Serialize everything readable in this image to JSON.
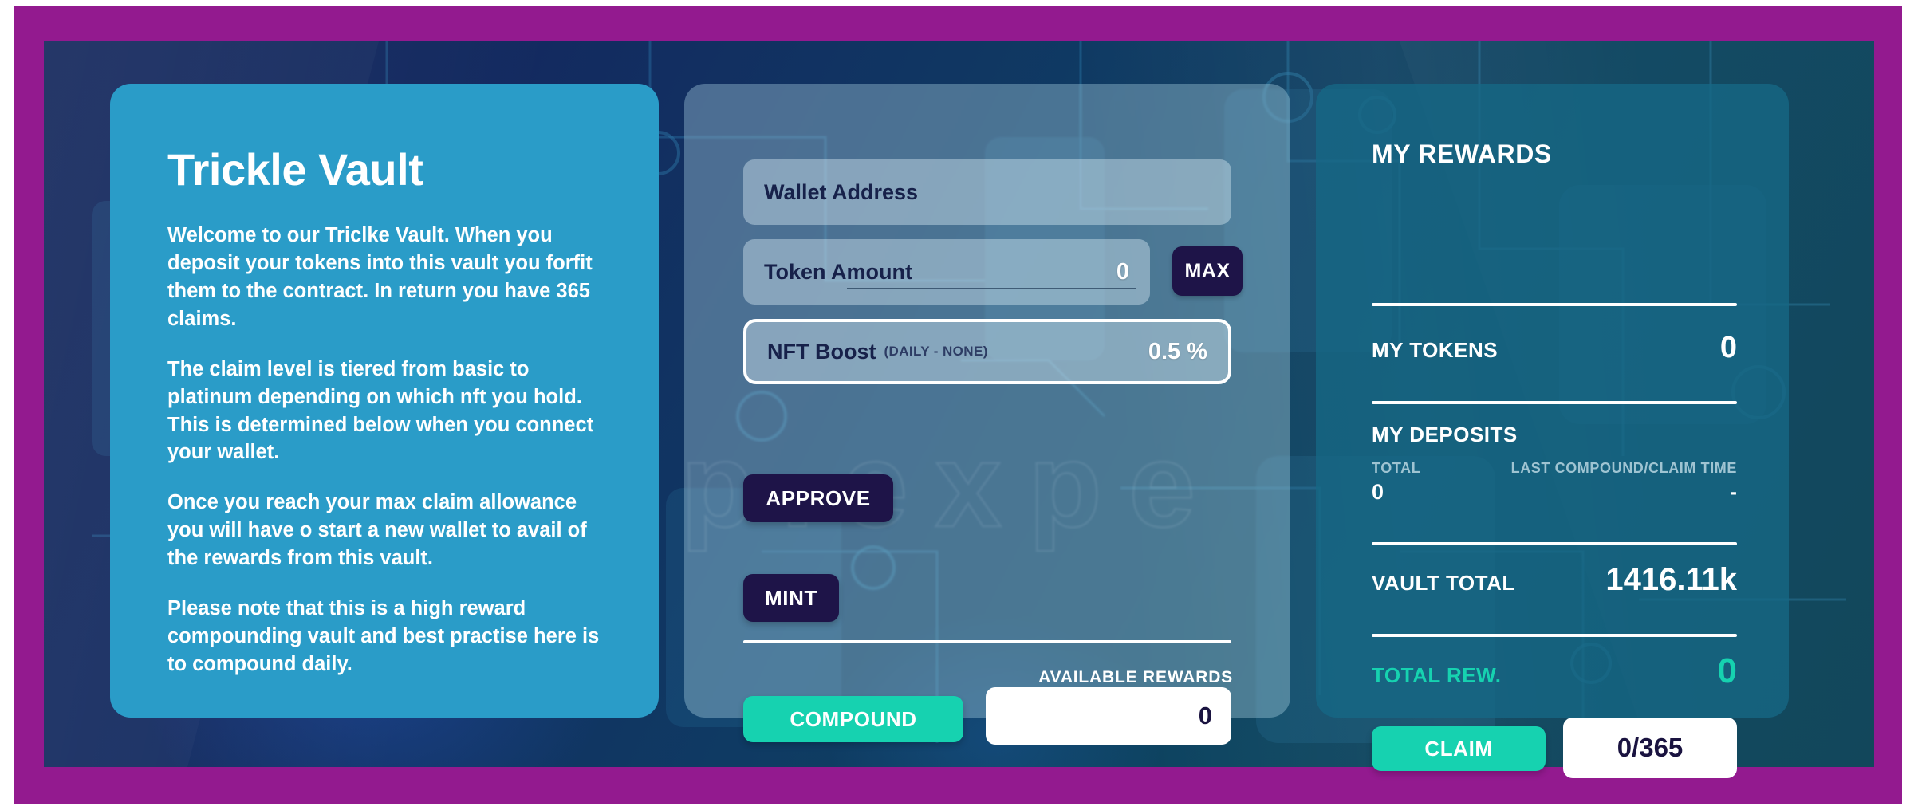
{
  "theme": {
    "frame_purple": "#931a8f",
    "left_panel_blue": "#2a9cc8",
    "accent_teal": "#16d2b0",
    "button_navy": "#1e1448",
    "background_navy": "#13265c"
  },
  "watermark": "dapp.expe",
  "left_panel": {
    "title": "Trickle Vault",
    "paragraphs": [
      "Welcome to our Triclke Vault. When you deposit your tokens into this vault you forfit them to the contract. In return you have 365 claims.",
      "The claim level is tiered from basic to platinum depending on which nft you hold. This is determined below when you connect your wallet.",
      "Once you reach your max claim allowance you will have o start a new wallet to avail of the rewards from this vault.",
      "Please note that this is a high reward compounding vault and best practise here is to compound daily."
    ]
  },
  "middle_panel": {
    "wallet_field": {
      "label": "Wallet Address",
      "value": ""
    },
    "token_field": {
      "label": "Token Amount",
      "value": "0"
    },
    "max_button": "MAX",
    "nft_field": {
      "label": "NFT Boost",
      "sub_label": "(DAILY - NONE)",
      "value": "0.5 %"
    },
    "approve_button": "APPROVE",
    "mint_button": "MINT",
    "available_rewards_label": "AVAILABLE REWARDS",
    "compound_button": "COMPOUND",
    "available_rewards_value": "0"
  },
  "right_panel": {
    "title": "MY REWARDS",
    "my_tokens": {
      "label": "MY TOKENS",
      "value": "0"
    },
    "my_deposits": {
      "label": "MY DEPOSITS",
      "total_label": "TOTAL",
      "total_value": "0",
      "last_time_label": "LAST COMPOUND/CLAIM TIME",
      "last_time_value": "-"
    },
    "vault_total": {
      "label": "VAULT TOTAL",
      "value": "1416.11k"
    },
    "total_reward": {
      "label": "TOTAL REW.",
      "value": "0"
    },
    "claim_button": "CLAIM",
    "claim_count": "0/365"
  }
}
